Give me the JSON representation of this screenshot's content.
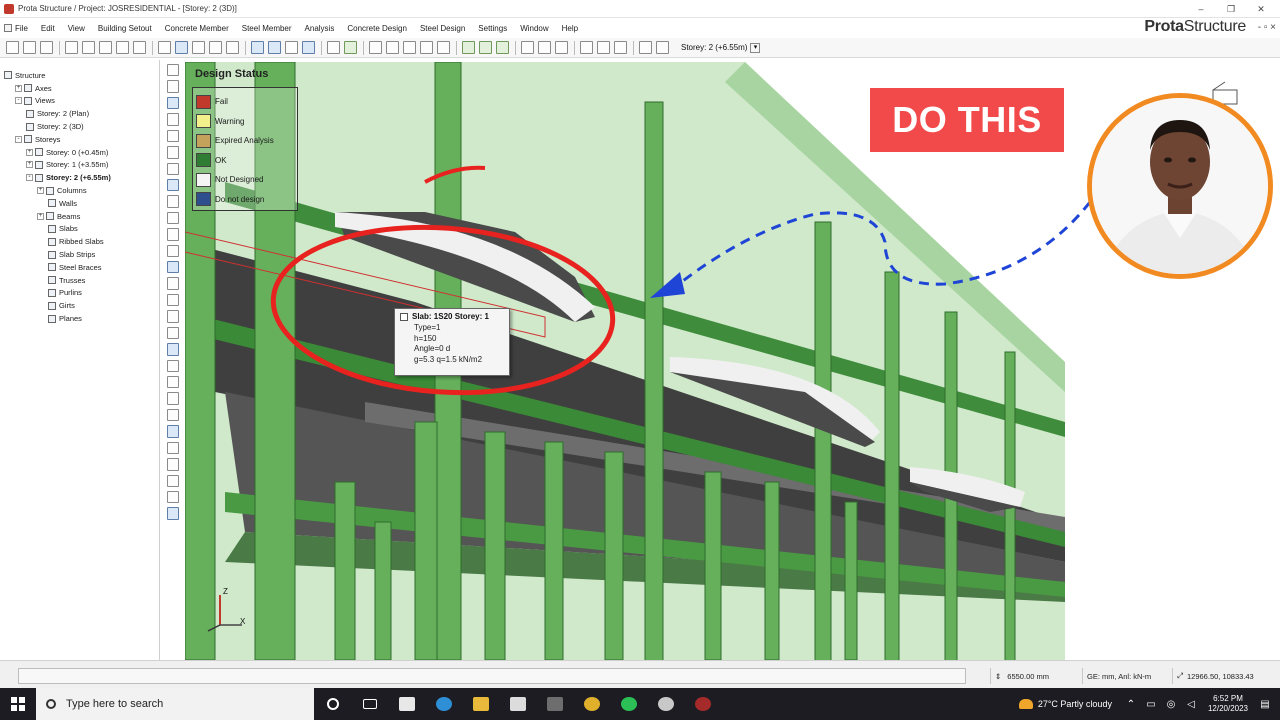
{
  "window": {
    "title": "Prota Structure / Project: JOSRESIDENTIAL - [Storey: 2 (3D)]",
    "controls": [
      "–",
      "❐",
      "✕"
    ]
  },
  "brand": {
    "bold": "Prota",
    "rest": "Structure",
    "controls": "- ▫ ×"
  },
  "menu": [
    "File",
    "Edit",
    "View",
    "Building Setout",
    "Concrete Member",
    "Steel Member",
    "Analysis",
    "Concrete Design",
    "Steel Design",
    "Settings",
    "Window",
    "Help"
  ],
  "toolbar": {
    "storey_label": "Storey: 2 (+6.55m)"
  },
  "tree": [
    {
      "label": "Structure",
      "level": 0,
      "exp": ""
    },
    {
      "label": "Axes",
      "level": 1,
      "exp": "+"
    },
    {
      "label": "Views",
      "level": 1,
      "exp": "-"
    },
    {
      "label": "Storey: 2 (Plan)",
      "level": 2,
      "exp": ""
    },
    {
      "label": "Storey: 2 (3D)",
      "level": 2,
      "exp": ""
    },
    {
      "label": "Storeys",
      "level": 1,
      "exp": "-"
    },
    {
      "label": "Storey: 0 (+0.45m)",
      "level": 2,
      "exp": "+"
    },
    {
      "label": "Storey: 1 (+3.55m)",
      "level": 2,
      "exp": "+"
    },
    {
      "label": "Storey: 2 (+6.55m)",
      "level": 2,
      "exp": "-",
      "bold": true
    },
    {
      "label": "Columns",
      "level": 3,
      "exp": "+"
    },
    {
      "label": "Walls",
      "level": 4,
      "exp": ""
    },
    {
      "label": "Beams",
      "level": 3,
      "exp": "+"
    },
    {
      "label": "Slabs",
      "level": 4,
      "exp": ""
    },
    {
      "label": "Ribbed Slabs",
      "level": 4,
      "exp": ""
    },
    {
      "label": "Slab Strips",
      "level": 4,
      "exp": ""
    },
    {
      "label": "Steel Braces",
      "level": 4,
      "exp": ""
    },
    {
      "label": "Trusses",
      "level": 4,
      "exp": ""
    },
    {
      "label": "Purlins",
      "level": 4,
      "exp": ""
    },
    {
      "label": "Girts",
      "level": 4,
      "exp": ""
    },
    {
      "label": "Planes",
      "level": 4,
      "exp": ""
    }
  ],
  "legend": {
    "title": "Design Status",
    "items": [
      {
        "label": "Fail",
        "color": "#c0392b"
      },
      {
        "label": "Warning",
        "color": "#f2f08a"
      },
      {
        "label": "Expired Analysis",
        "color": "#c4a25c"
      },
      {
        "label": "OK",
        "color": "#2f7d32"
      },
      {
        "label": "Not Designed",
        "color": "#f4f4f4"
      },
      {
        "label": "Do not design",
        "color": "#2d4f8e"
      }
    ]
  },
  "tooltip": {
    "title": "Slab: 1S20 Storey: 1",
    "lines": [
      "Type=1",
      "h=150",
      "Angle=0 d",
      "g=5.3  q=1.5 kN/m2"
    ]
  },
  "callout": {
    "text": "DO THIS",
    "color": "#f24a4a"
  },
  "axes": {
    "z": "Z",
    "x": "X"
  },
  "status": {
    "elevation": "6550.00 mm",
    "units": "GE: mm,  Anl: kN-m",
    "coords": "12966.50, 10833.43"
  },
  "taskbar": {
    "search_placeholder": "Type here to search",
    "weather": "27°C  Partly cloudy",
    "time": "6:52 PM",
    "date": "12/20/2023"
  }
}
